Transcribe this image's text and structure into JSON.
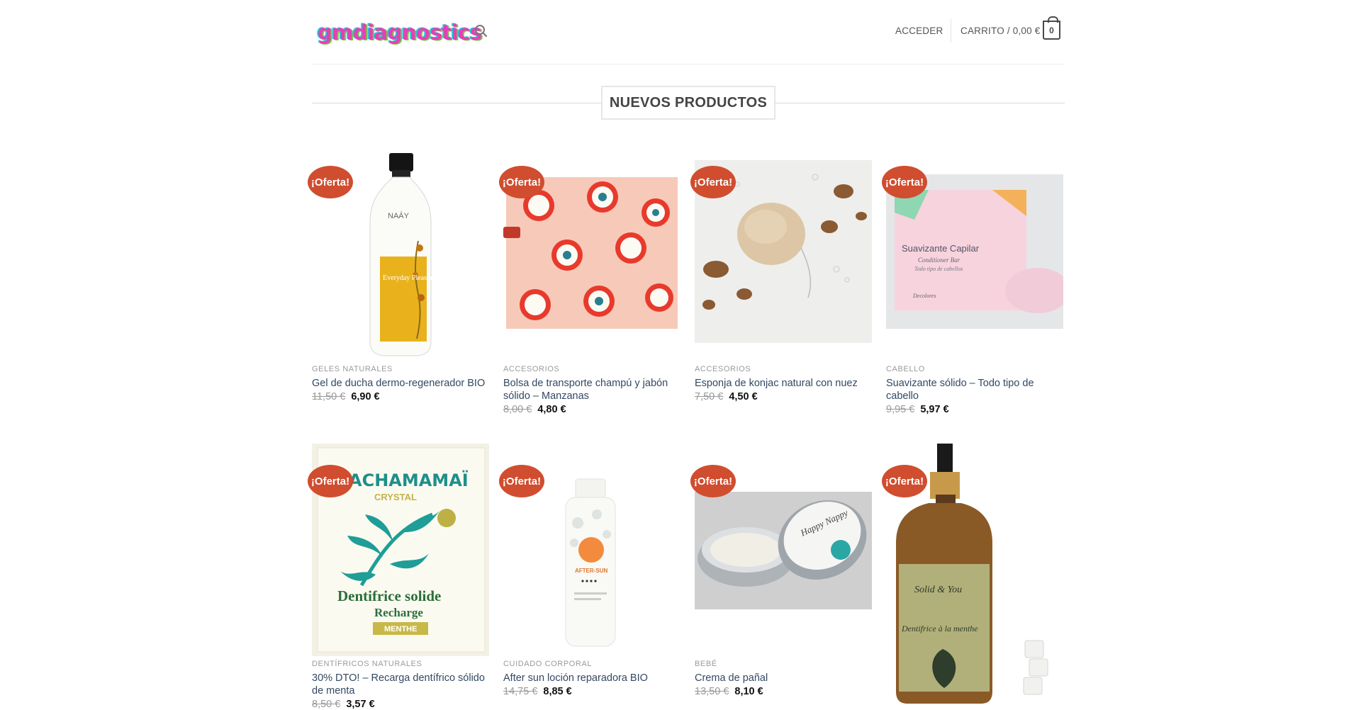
{
  "header": {
    "logo_text": "gmdiagnostics",
    "search_icon": "search-icon",
    "login_label": "ACCEDER",
    "cart_label": "CARRITO / 0,00 €",
    "cart_count": "0"
  },
  "section": {
    "title": "NUEVOS PRODUCTOS"
  },
  "colors": {
    "accent": "#d04d2f",
    "link": "#334862",
    "category": "#9a9a9a"
  },
  "products": [
    {
      "badge": "¡Oferta!",
      "category": "GELES NATURALES",
      "title": "Gel de ducha dermo-regenerador BIO",
      "old_price": "11,50 €",
      "price": "6,90 €",
      "image": "shower-gel-bottle"
    },
    {
      "badge": "¡Oferta!",
      "category": "ACCESORIOS",
      "title": "Bolsa de transporte champú y jabón sólido – Manzanas",
      "old_price": "8,00 €",
      "price": "4,80 €",
      "image": "apple-print-bag"
    },
    {
      "badge": "¡Oferta!",
      "category": "ACCESORIOS",
      "title": "Esponja de konjac natural con nuez",
      "old_price": "7,50 €",
      "price": "4,50 €",
      "image": "konjac-sponge"
    },
    {
      "badge": "¡Oferta!",
      "category": "CABELLO",
      "title": "Suavizante sólido – Todo tipo de cabello",
      "old_price": "9,95 €",
      "price": "5,97 €",
      "image": "conditioner-bar-box"
    },
    {
      "badge": "¡Oferta!",
      "category": "DENTÍFRICOS NATURALES",
      "title": "30% DTO! – Recarga dentífrico sólido de menta",
      "old_price": "8,50 €",
      "price": "3,57 €",
      "image": "toothpaste-refill-box"
    },
    {
      "badge": "¡Oferta!",
      "category": "CUIDADO CORPORAL",
      "title": "After sun loción reparadora BIO",
      "old_price": "14,75 €",
      "price": "8,85 €",
      "image": "after-sun-bottle"
    },
    {
      "badge": "¡Oferta!",
      "category": "BEBÉ",
      "title": "Crema de pañal",
      "old_price": "13,50 €",
      "price": "8,10 €",
      "image": "diaper-cream-tin"
    },
    {
      "badge": "¡Oferta!",
      "category": "",
      "title": "",
      "old_price": "",
      "price": "",
      "image": "toothpaste-tablets-bottle"
    }
  ],
  "product_images": {
    "p1_brand": "NAÁY",
    "p1_label": "Everyday Pleasure",
    "p4_box_title": "Suavizante Capilar",
    "p4_box_sub": "Conditioner Bar",
    "p4_box_sub2": "Todo tipo de cabellos",
    "p4_brand": "Decolores",
    "p5_brand": "ACHAMAMAÏ",
    "p5_crystal": "CRYSTAL",
    "p5_name1": "Dentifrice solide",
    "p5_name2": "Recharge",
    "p5_flavor": "MENTHE",
    "p6_label": "AFTER-SUN",
    "p7_label": "Happy Nappy",
    "p8_brand": "Solid & You",
    "p8_label": "Dentifrice à la menthe"
  }
}
